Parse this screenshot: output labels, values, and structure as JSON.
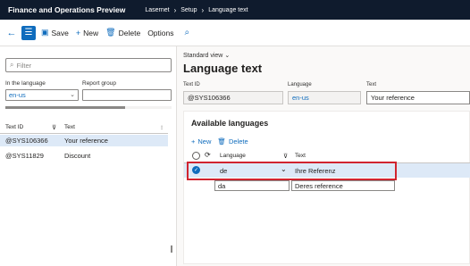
{
  "topbar": {
    "app_title": "Finance and Operations Preview",
    "breadcrumbs": [
      "Lasernet",
      "Setup",
      "Language text"
    ]
  },
  "actionbar": {
    "save": "Save",
    "new": "New",
    "delete": "Delete",
    "options": "Options"
  },
  "left": {
    "filter_placeholder": "Filter",
    "in_language_label": "In the language",
    "in_language_value": "en-us",
    "report_group_label": "Report group",
    "grid": {
      "headers": [
        "Text ID",
        "Text"
      ],
      "rows": [
        {
          "id": "@SYS106366",
          "text": "Your reference"
        },
        {
          "id": "@SYS11829",
          "text": "Discount"
        }
      ]
    }
  },
  "form": {
    "view": "Standard view",
    "title": "Language text",
    "fields": {
      "text_id_label": "Text ID",
      "text_id_value": "@SYS106366",
      "language_label": "Language",
      "language_value": "en-us",
      "text_label": "Text",
      "text_value": "Your reference"
    },
    "card": {
      "title": "Available languages",
      "new": "New",
      "delete": "Delete",
      "headers": [
        "Language",
        "Text"
      ],
      "rows": [
        {
          "language": "de",
          "text": "Ihre Referenz"
        },
        {
          "language": "da",
          "text": "Deres reference"
        }
      ]
    }
  },
  "colors": {
    "accent": "#0f6cbd",
    "topbar": "#0f1b2d",
    "selected_row": "#dde9f7",
    "highlight": "#d1242f"
  }
}
